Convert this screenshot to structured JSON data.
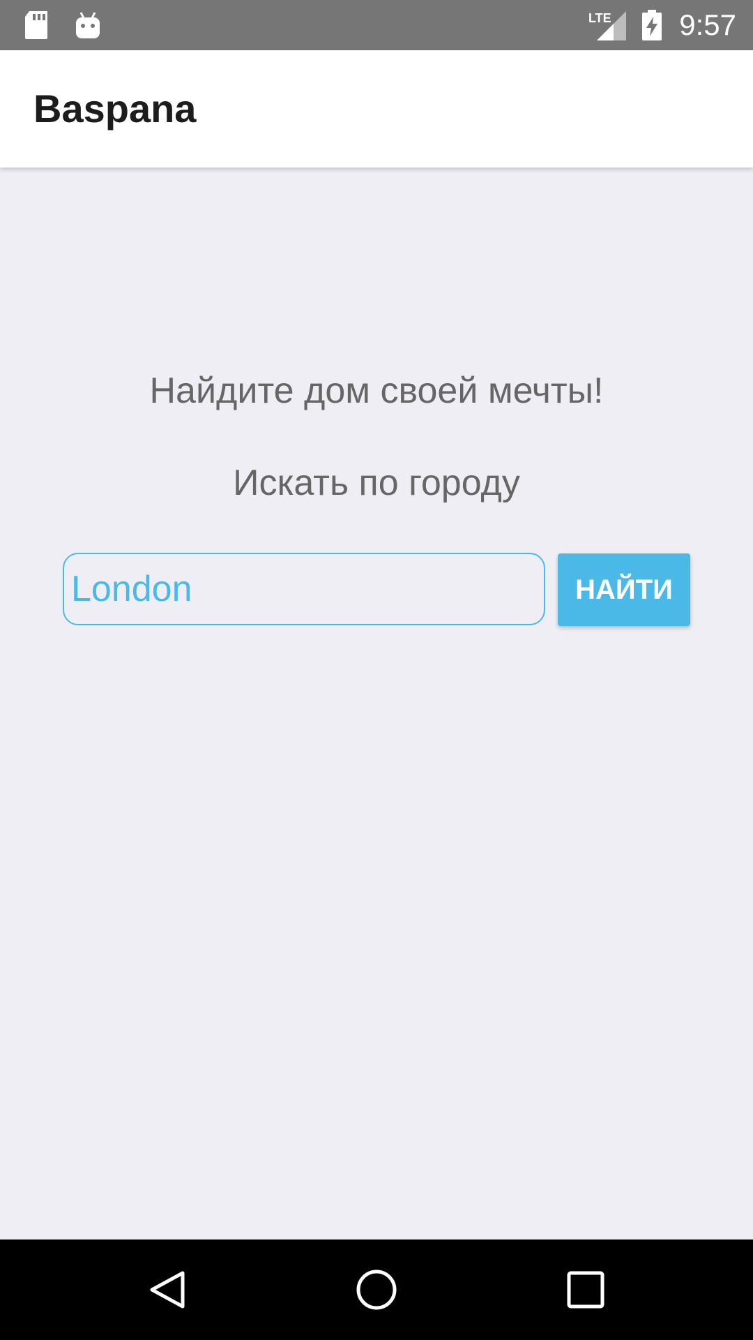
{
  "status_bar": {
    "time": "9:57",
    "network_label": "LTE",
    "icons": [
      "sd-card-icon",
      "android-icon",
      "lte-signal-icon",
      "battery-charging-icon"
    ]
  },
  "app_bar": {
    "title": "Baspana"
  },
  "main": {
    "headline": "Найдите дом своей мечты!",
    "subheadline": "Искать по городу",
    "search": {
      "value": "",
      "placeholder": "London"
    },
    "find_button_label": "НАЙТИ"
  },
  "nav_bar": {
    "icons": [
      "back-icon",
      "home-icon",
      "recents-icon"
    ]
  },
  "colors": {
    "accent": "#4ab9e8",
    "background": "#efeef4",
    "status_bar": "#767676",
    "text_secondary": "#666666"
  }
}
